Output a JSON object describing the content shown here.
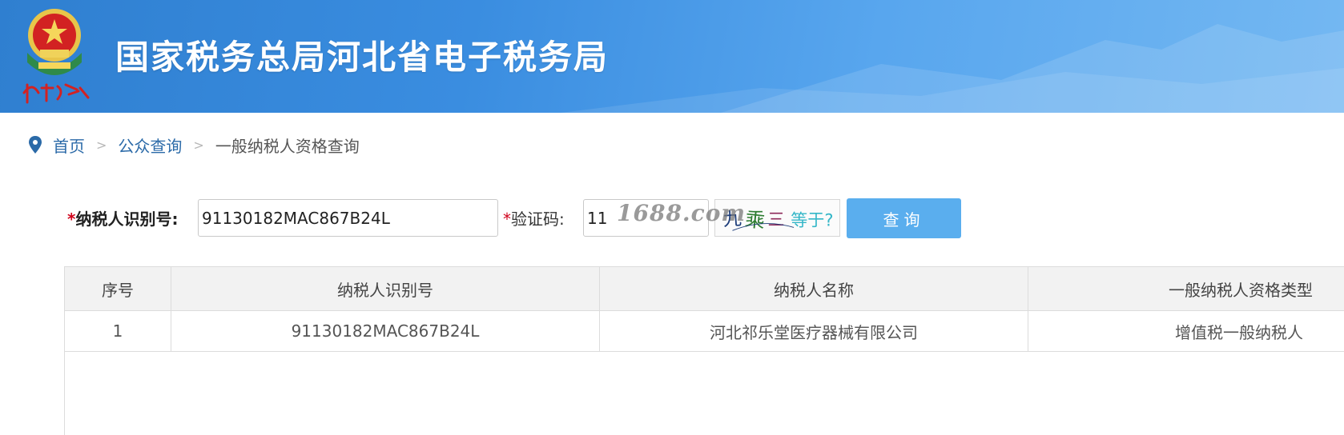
{
  "header": {
    "title": "国家税务总局河北省电子税务局",
    "logo_caption": "中国税务"
  },
  "breadcrumb": {
    "home": "首页",
    "section": "公众查询",
    "current": "一般纳税人资格查询",
    "separator": ">"
  },
  "form": {
    "required_mark": "*",
    "taxpayer_id_label": "纳税人识别号:",
    "taxpayer_id_value": "91130182MAC867B24L",
    "captcha_label": "验证码:",
    "captcha_value": "11",
    "captcha_image_text": "九 乘 三 等于?",
    "query_button": "查询"
  },
  "watermark": "1688.com",
  "table": {
    "columns": [
      "序号",
      "纳税人识别号",
      "纳税人名称",
      "一般纳税人资格类型"
    ],
    "rows": [
      [
        "1",
        "91130182MAC867B24L",
        "河北祁乐堂医疗器械有限公司",
        "增值税一般纳税人"
      ]
    ]
  },
  "colors": {
    "banner": "#3a8de0",
    "link": "#2b6aa8",
    "button": "#5aaeee",
    "required": "#d0021b"
  },
  "icons": {
    "breadcrumb": "location-pin-icon",
    "logo": "tax-emblem-icon"
  }
}
